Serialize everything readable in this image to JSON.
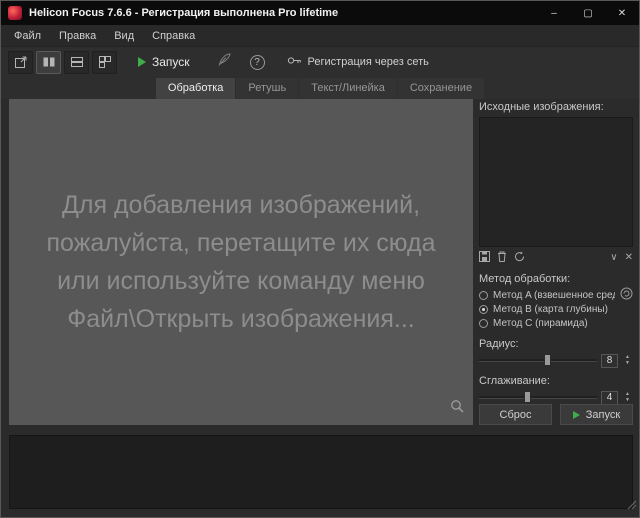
{
  "window": {
    "title": "Helicon Focus 7.6.6 - Регистрация выполнена Pro lifetime",
    "controls": {
      "minimize": "–",
      "maximize": "▢",
      "close": "✕"
    }
  },
  "menu": {
    "items": [
      "Файл",
      "Правка",
      "Вид",
      "Справка"
    ]
  },
  "toolbar": {
    "run_label": "Запуск",
    "help_glyph": "?",
    "register_label": "Регистрация через сеть"
  },
  "tabs": [
    {
      "label": "Обработка",
      "active": true
    },
    {
      "label": "Ретушь",
      "active": false
    },
    {
      "label": "Текст/Линейка",
      "active": false
    },
    {
      "label": "Сохранение",
      "active": false
    }
  ],
  "drop_area": {
    "lines": [
      "Для добавления изображений,",
      "пожалуйста, перетащите их сюда",
      "или используйте команду меню",
      "Файл\\Открыть изображения..."
    ]
  },
  "sources": {
    "title": "Исходные изображения:",
    "collapse_glyph": "∨",
    "close_glyph": "✕"
  },
  "method": {
    "title": "Метод обработки:",
    "options": [
      {
        "label": "Метод A (взвешенное среднее)",
        "selected": false
      },
      {
        "label": "Метод B (карта глубины)",
        "selected": true
      },
      {
        "label": "Метод C (пирамида)",
        "selected": false
      }
    ]
  },
  "params": {
    "radius_label": "Радиус:",
    "radius_value": "8",
    "smoothing_label": "Сглаживание:",
    "smoothing_value": "4",
    "step_up_glyph": "▲",
    "step_down_glyph": "▼"
  },
  "actions": {
    "reset": "Сброс",
    "run": "Запуск"
  },
  "colors": {
    "accent_green": "#3fae4a",
    "drop_bg": "#575757",
    "titlebar": "#0b0b0b"
  }
}
